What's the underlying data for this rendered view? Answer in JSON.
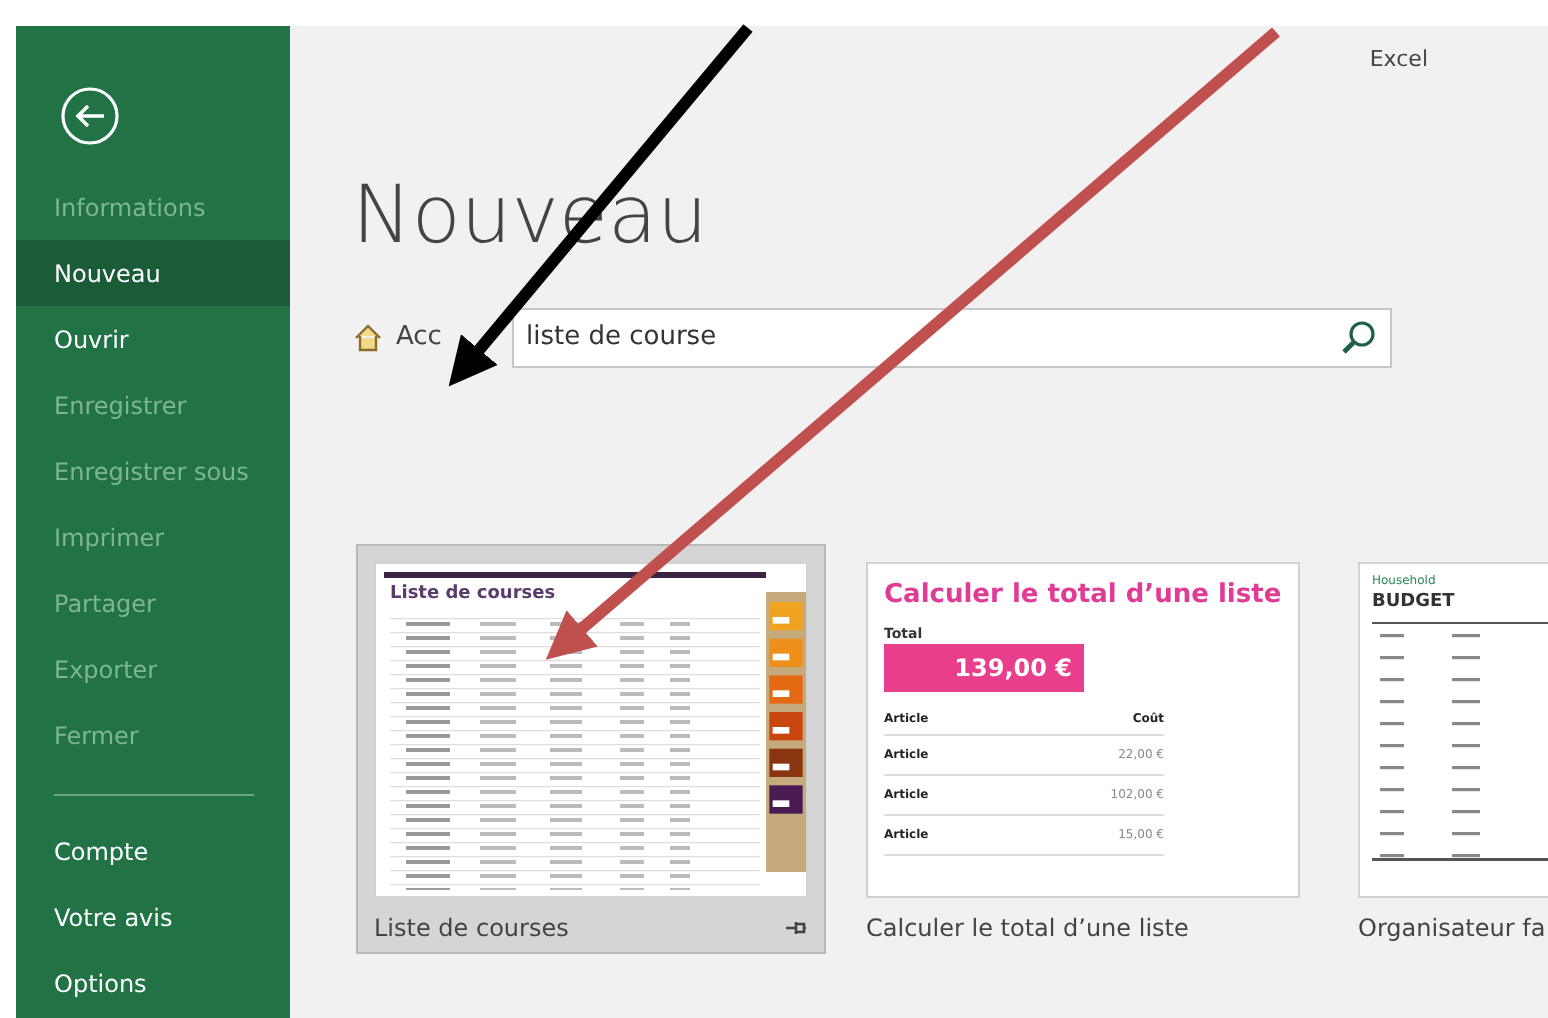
{
  "app_name": "Excel",
  "sidebar": {
    "items": [
      {
        "label": "Informations",
        "selected": false,
        "disabled": true
      },
      {
        "label": "Nouveau",
        "selected": true,
        "disabled": false
      },
      {
        "label": "Ouvrir",
        "selected": false,
        "disabled": false
      },
      {
        "label": "Enregistrer",
        "selected": false,
        "disabled": true
      },
      {
        "label": "Enregistrer sous",
        "selected": false,
        "disabled": true
      },
      {
        "label": "Imprimer",
        "selected": false,
        "disabled": true
      },
      {
        "label": "Partager",
        "selected": false,
        "disabled": true
      },
      {
        "label": "Exporter",
        "selected": false,
        "disabled": true
      },
      {
        "label": "Fermer",
        "selected": false,
        "disabled": true
      }
    ],
    "bottom_items": [
      {
        "label": "Compte",
        "selected": false,
        "disabled": false
      },
      {
        "label": "Votre avis",
        "selected": false,
        "disabled": false
      },
      {
        "label": "Options",
        "selected": false,
        "disabled": false
      }
    ]
  },
  "page_title": "Nouveau",
  "breadcrumb": "Acc",
  "search": {
    "value": "liste de course"
  },
  "templates": [
    {
      "kind": "shopping-list",
      "caption": "Liste de courses",
      "selected": true,
      "show_pin": true,
      "preview": {
        "title": "Liste de courses"
      }
    },
    {
      "kind": "total",
      "caption": "Calculer le total d’une liste",
      "selected": false,
      "show_pin": false,
      "preview": {
        "title": "Calculer le total d’une liste",
        "total_label": "Total",
        "total": "139,00 €",
        "headers": [
          "Article",
          "Coût"
        ],
        "rows": [
          {
            "item": "Article",
            "cost": "22,00 €"
          },
          {
            "item": "Article",
            "cost": "102,00 €"
          },
          {
            "item": "Article",
            "cost": "15,00 €"
          }
        ]
      }
    },
    {
      "kind": "budget",
      "caption": "Organisateur fa",
      "selected": false,
      "show_pin": false,
      "preview": {
        "subtitle": "Household",
        "title": "BUDGET"
      }
    }
  ]
}
